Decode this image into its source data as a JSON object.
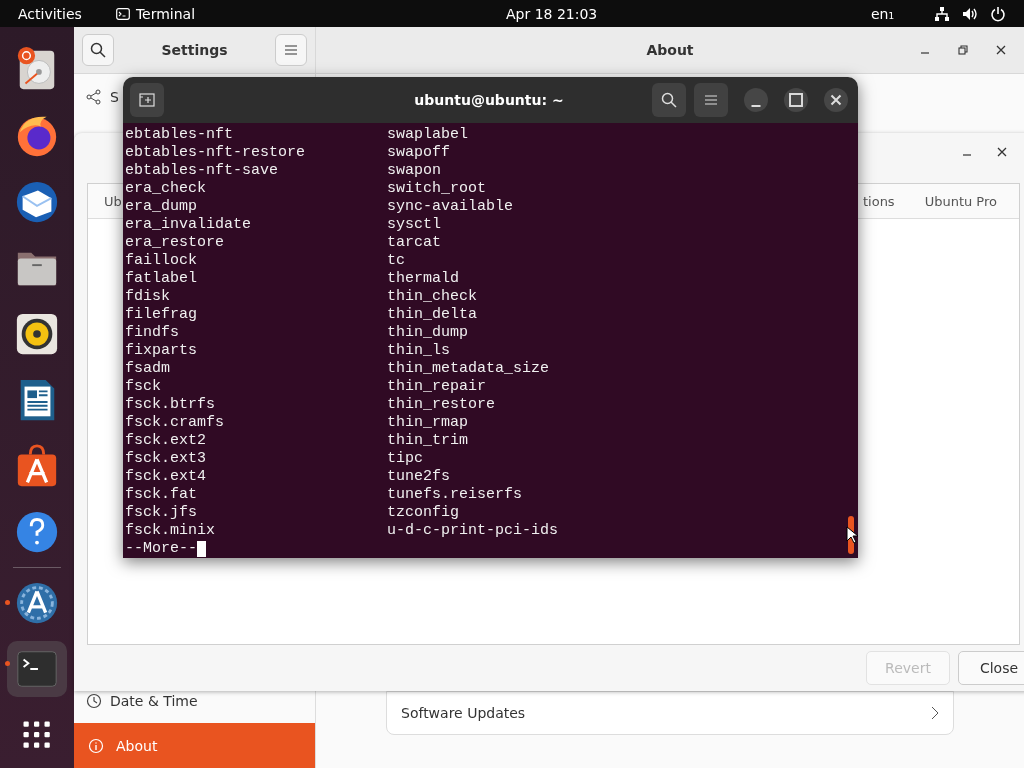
{
  "top_bar": {
    "activities": "Activities",
    "app": "Terminal",
    "clock": "Apr 18  21:03",
    "keyboard": "en₁"
  },
  "dock": {
    "items": [
      {
        "kind": "disk",
        "running": false,
        "selected": false
      },
      {
        "kind": "browser",
        "running": false,
        "selected": false
      },
      {
        "kind": "mail",
        "running": false,
        "selected": false
      },
      {
        "kind": "folder",
        "running": false,
        "selected": false
      },
      {
        "kind": "speaker",
        "running": false,
        "selected": false
      },
      {
        "kind": "document",
        "running": false,
        "selected": false
      },
      {
        "kind": "bag",
        "running": false,
        "selected": false
      },
      {
        "kind": "help",
        "running": false,
        "selected": false
      },
      {
        "kind": "separator"
      },
      {
        "kind": "updater",
        "running": true,
        "selected": false
      },
      {
        "kind": "terminal",
        "running": true,
        "selected": true
      },
      {
        "kind": "grid",
        "running": false,
        "selected": false
      }
    ]
  },
  "settings": {
    "title": "Settings",
    "page_title": "About",
    "sidebar": {
      "items": [
        {
          "label": "S",
          "selected": false
        },
        {
          "label": "Date & Time",
          "selected": false
        },
        {
          "label": "About",
          "selected": true
        }
      ]
    },
    "rows": [
      {
        "label": "Software Updates"
      }
    ]
  },
  "dialog": {
    "tabs": [
      {
        "label": "Ub",
        "selected": false
      },
      {
        "label": "tions",
        "selected": false
      },
      {
        "label": "Ubuntu Pro",
        "selected": false
      }
    ],
    "buttons": [
      {
        "label": "Revert",
        "disabled": true
      },
      {
        "label": "Close",
        "disabled": false
      }
    ]
  },
  "terminal": {
    "title": "ubuntu@ubuntu: ~",
    "rows": [
      [
        "ebtables-nft",
        "swaplabel"
      ],
      [
        "ebtables-nft-restore",
        "swapoff"
      ],
      [
        "ebtables-nft-save",
        "swapon"
      ],
      [
        "era_check",
        "switch_root"
      ],
      [
        "era_dump",
        "sync-available"
      ],
      [
        "era_invalidate",
        "sysctl"
      ],
      [
        "era_restore",
        "tarcat"
      ],
      [
        "faillock",
        "tc"
      ],
      [
        "fatlabel",
        "thermald"
      ],
      [
        "fdisk",
        "thin_check"
      ],
      [
        "filefrag",
        "thin_delta"
      ],
      [
        "findfs",
        "thin_dump"
      ],
      [
        "fixparts",
        "thin_ls"
      ],
      [
        "fsadm",
        "thin_metadata_size"
      ],
      [
        "fsck",
        "thin_repair"
      ],
      [
        "fsck.btrfs",
        "thin_restore"
      ],
      [
        "fsck.cramfs",
        "thin_rmap"
      ],
      [
        "fsck.ext2",
        "thin_trim"
      ],
      [
        "fsck.ext3",
        "tipc"
      ],
      [
        "fsck.ext4",
        "tune2fs"
      ],
      [
        "fsck.fat",
        "tunefs.reiserfs"
      ],
      [
        "fsck.jfs",
        "tzconfig"
      ],
      [
        "fsck.minix",
        "u-d-c-print-pci-ids"
      ]
    ],
    "prompt": "--More--"
  }
}
